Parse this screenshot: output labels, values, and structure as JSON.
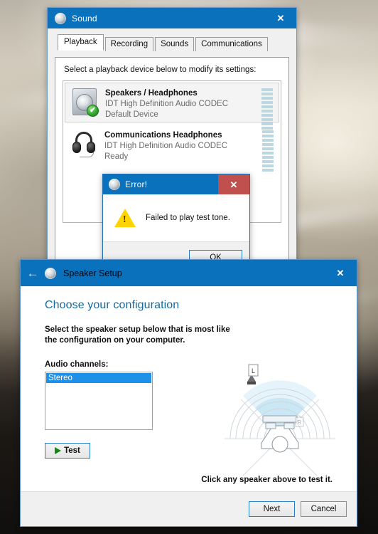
{
  "sound_window": {
    "title": "Sound",
    "icon": "speaker-icon",
    "close_label": "✕",
    "tabs": [
      {
        "label": "Playback",
        "active": true
      },
      {
        "label": "Recording",
        "active": false
      },
      {
        "label": "Sounds",
        "active": false
      },
      {
        "label": "Communications",
        "active": false
      }
    ],
    "panel_instruction": "Select a playback device below to modify its settings:",
    "devices": [
      {
        "name": "Speakers / Headphones",
        "driver": "IDT High Definition Audio CODEC",
        "status": "Default Device",
        "selected": true,
        "has_default_check": true,
        "icon": "speaker-box-icon",
        "meter_segments": 10,
        "check_glyph": "✔"
      },
      {
        "name": "Communications Headphones",
        "driver": "IDT High Definition Audio CODEC",
        "status": "Ready",
        "selected": false,
        "has_default_check": false,
        "icon": "headphones-icon",
        "meter_segments": 10
      }
    ]
  },
  "error_dialog": {
    "title": "Error!",
    "icon": "speaker-icon",
    "close_label": "✕",
    "close_color": "#c0504d",
    "warning_glyph": "!",
    "message": "Failed to play test tone.",
    "ok_label": "OK"
  },
  "speaker_setup": {
    "title": "Speaker Setup",
    "icon": "speaker-setup-icon",
    "back_glyph": "←",
    "close_label": "✕",
    "heading": "Choose your configuration",
    "heading_color": "#16699e",
    "description_line1": "Select the speaker setup below that is most like",
    "description_line2": "the configuration on your computer.",
    "channels_label": "Audio channels:",
    "channel_options": [
      {
        "label": "Stereo",
        "selected": true
      }
    ],
    "test_label": "Test",
    "hint": "Click any speaker above to test it.",
    "next_label": "Next",
    "cancel_label": "Cancel",
    "diagram": {
      "left_speaker_tag": "L",
      "right_speaker_tag": "R"
    }
  }
}
